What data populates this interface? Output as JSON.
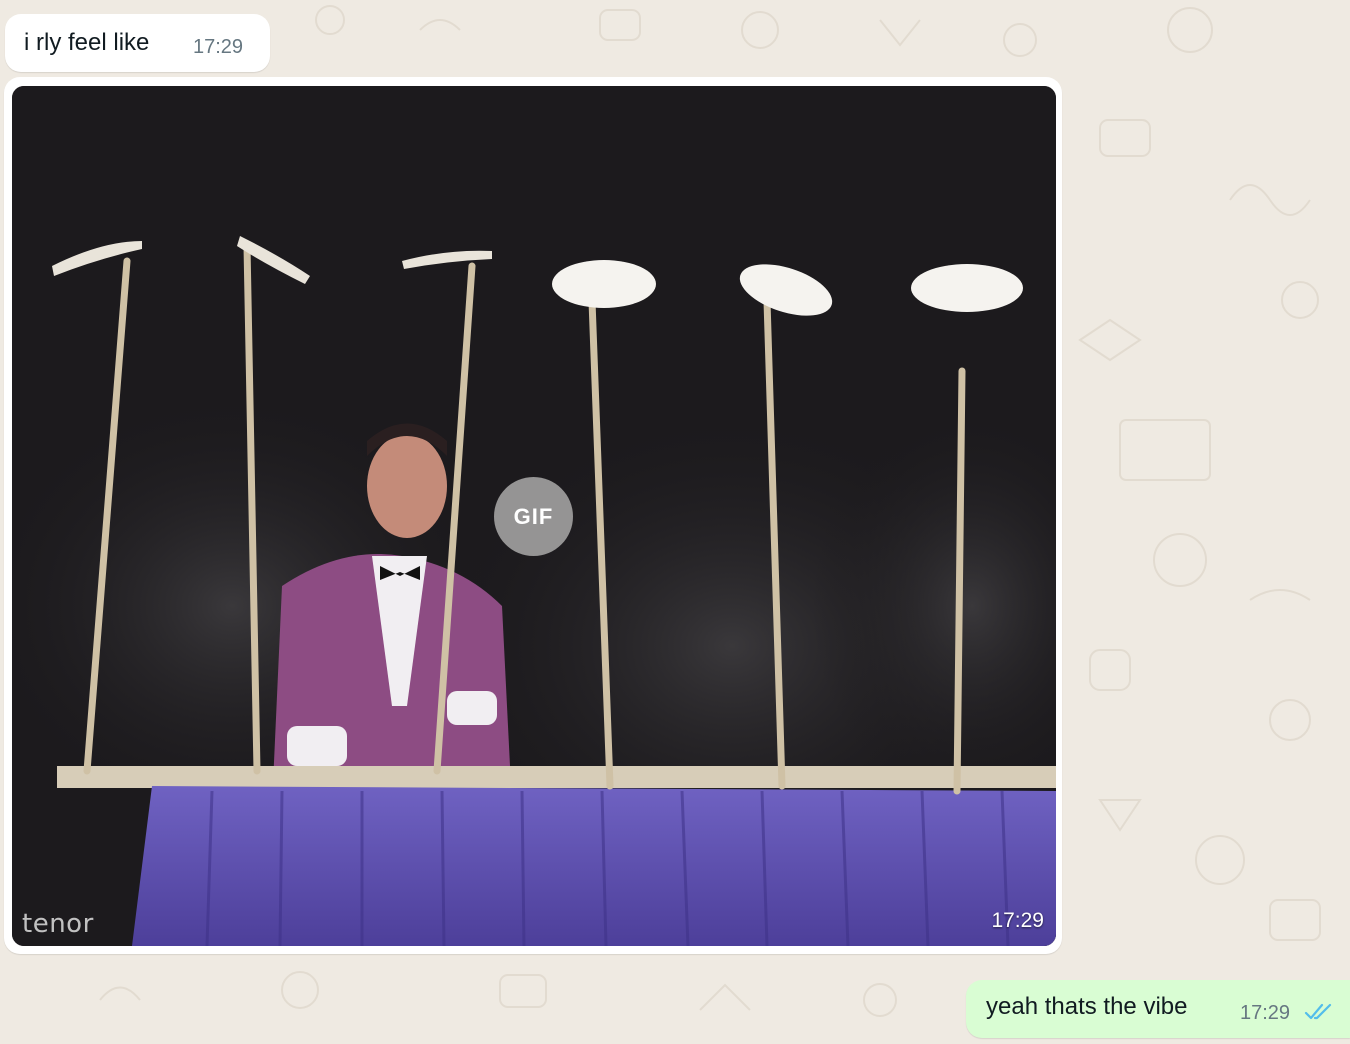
{
  "colors": {
    "chat_background": "#efeae2",
    "incoming_bubble": "#ffffff",
    "outgoing_bubble": "#d9fdd3",
    "timestamp": "#667781",
    "read_ticks": "#53bdeb"
  },
  "messages": [
    {
      "direction": "incoming",
      "type": "text",
      "text": "i rly feel like",
      "time": "17:29"
    },
    {
      "direction": "incoming",
      "type": "gif",
      "badge": "GIF",
      "provider": "tenor",
      "time": "17:29"
    },
    {
      "direction": "outgoing",
      "type": "text",
      "text": "yeah thats the vibe",
      "time": "17:29",
      "status_icon": "double-check-read-icon"
    }
  ]
}
